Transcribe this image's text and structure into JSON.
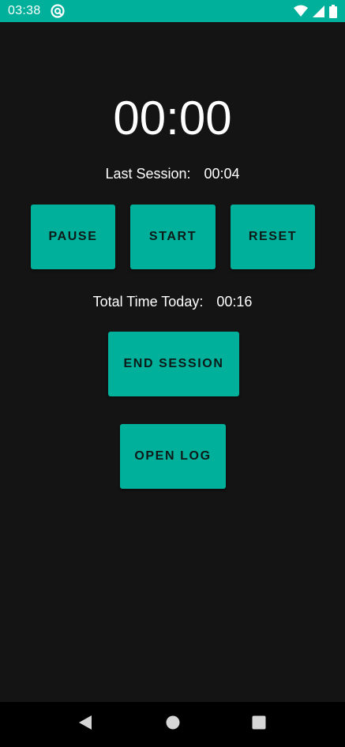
{
  "status_bar": {
    "time": "03:38",
    "background_color": "#00b09a",
    "icons": [
      "sync-icon",
      "wifi-icon",
      "signal-icon",
      "battery-icon"
    ]
  },
  "timer": {
    "display": "00:00"
  },
  "last_session": {
    "label": "Last Session:",
    "value": "00:04"
  },
  "controls": {
    "pause_label": "PAUSE",
    "start_label": "START",
    "reset_label": "RESET"
  },
  "total_time": {
    "label": "Total Time Today:",
    "value": "00:16"
  },
  "end_session_label": "END SESSION",
  "open_log_label": "OPEN LOG",
  "theme": {
    "accent": "#00b09a",
    "background": "#141414",
    "nav_background": "#000000"
  },
  "nav_bar": {
    "icons": [
      "back-icon",
      "home-icon",
      "recents-icon"
    ]
  }
}
